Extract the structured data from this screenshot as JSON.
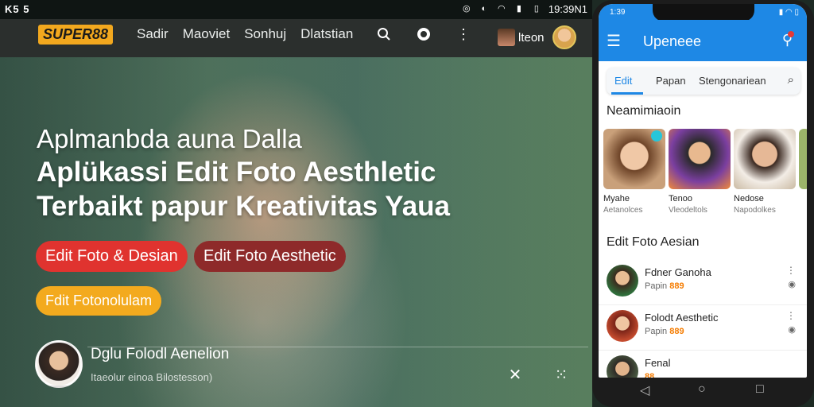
{
  "status_bar": {
    "left_text": "K5 5",
    "time": "19:39N1"
  },
  "brand": {
    "logo": "SUPER88"
  },
  "nav": {
    "items": [
      "Sadir",
      "Maoviet",
      "Sonhuj",
      "Dlatstian"
    ]
  },
  "user": {
    "name": "lteon"
  },
  "hero": {
    "line1": "Aplmanbda auna Dalla",
    "line2": "Aplükassi Edit Foto Aesthletic",
    "line3": "Terbaikt papur Kreativitas Yaua",
    "chips": [
      "Edit Foto & Desian",
      "Edit Foto Aesthetic",
      "Fdit Fotonolulam"
    ]
  },
  "author": {
    "name": "Dglu Folodl Aenelion",
    "subtitle": "Itaeolur einoa Bilostesson)"
  },
  "phone": {
    "status_time": "1:39",
    "app_title": "Upeneee",
    "tabs": [
      "Edit",
      "Papan",
      "Stengonariean"
    ],
    "section_trending": "Neamimiaoin",
    "cards": [
      {
        "name": "Myahe",
        "sub": "Aetanolces"
      },
      {
        "name": "Tenoo",
        "sub": "Vleodeltols"
      },
      {
        "name": "Nedose",
        "sub": "Napodolkes"
      }
    ],
    "section_list": "Edit Foto Aesian",
    "list": [
      {
        "title": "Fdner Ganoha",
        "meta": "Papin",
        "tag": "889"
      },
      {
        "title": "Folodt Aesthetic",
        "meta": "Papin",
        "tag": "889"
      },
      {
        "title": "Fenal",
        "meta": "",
        "tag": "88"
      }
    ]
  },
  "colors": {
    "accent": "#1e88e5",
    "brand": "#f2a81e",
    "chip_red": "#e0332f",
    "chip_dark_red": "#8e2a2a",
    "chip_orange": "#f3aa1e"
  }
}
